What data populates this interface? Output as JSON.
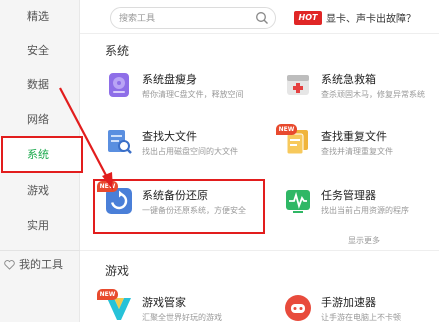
{
  "sidebar": {
    "items": [
      {
        "label": "精选"
      },
      {
        "label": "安全"
      },
      {
        "label": "数据"
      },
      {
        "label": "网络"
      },
      {
        "label": "系统"
      },
      {
        "label": "游戏"
      },
      {
        "label": "实用"
      }
    ],
    "active": "系统",
    "my_tools": "我的工具"
  },
  "search": {
    "placeholder": "搜索工具"
  },
  "promo": {
    "badge": "HOT",
    "text": "显卡、声卡出故障？"
  },
  "sections": [
    {
      "title": "系统",
      "tools": [
        {
          "name": "系统盘瘦身",
          "desc": "帮你清理C盘文件，释放空间",
          "icon": "disk-icon"
        },
        {
          "name": "系统急救箱",
          "desc": "查杀顽固木马，修复异常系统",
          "icon": "first-aid-icon"
        },
        {
          "name": "查找大文件",
          "desc": "找出占用磁盘空间的大文件",
          "icon": "find-file-icon"
        },
        {
          "name": "查找重复文件",
          "desc": "查找并清理重复文件",
          "icon": "duplicate-file-icon",
          "badge": "NEW"
        },
        {
          "name": "系统备份还原",
          "desc": "一键备份还原系统，方便安全",
          "icon": "backup-restore-icon",
          "badge": "NEW"
        },
        {
          "name": "任务管理器",
          "desc": "找出当前占用资源的程序",
          "icon": "task-manager-icon"
        }
      ],
      "show_more": "显示更多"
    },
    {
      "title": "游戏",
      "tools": [
        {
          "name": "游戏管家",
          "desc": "汇聚全世界好玩的游戏",
          "icon": "game-manager-icon",
          "badge": "NEW"
        },
        {
          "name": "手游加速器",
          "desc": "让手游在电脑上不卡顿",
          "icon": "mobile-game-icon"
        }
      ]
    }
  ],
  "colors": {
    "accent": "#1eaa4f",
    "highlight": "#e21d1d",
    "arrow": "#e21d1d"
  }
}
